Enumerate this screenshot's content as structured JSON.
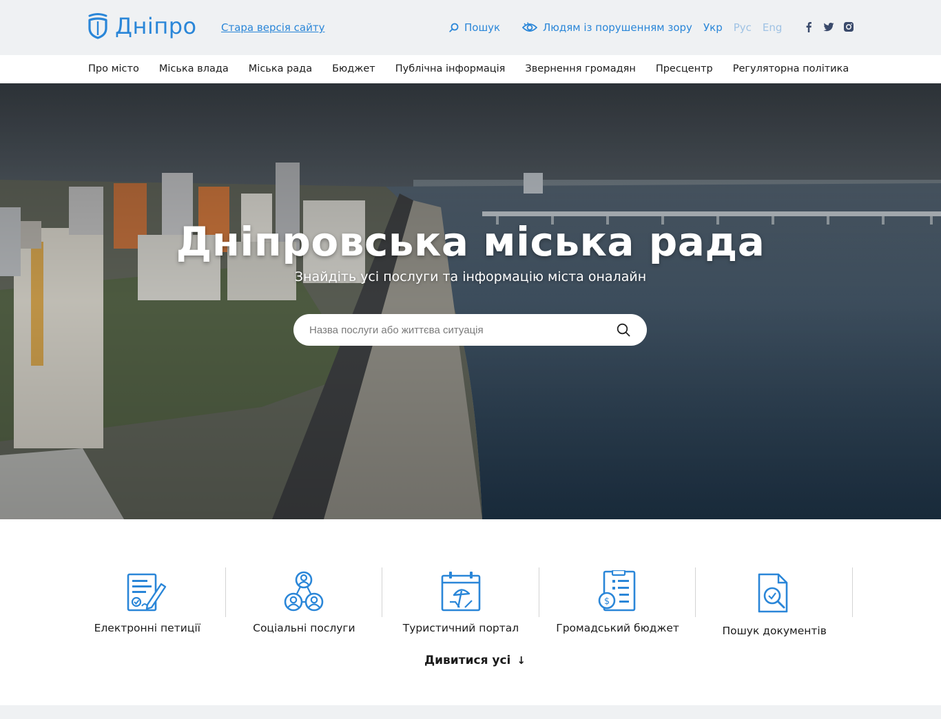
{
  "header": {
    "logo_text": "Дніпро",
    "old_site": "Стара версія сайту",
    "search": "Пошук",
    "vision": "Людям із порушенням зору",
    "languages": [
      "Укр",
      "Рус",
      "Eng"
    ],
    "active_language": "Укр",
    "socials": [
      "facebook-icon",
      "twitter-icon",
      "instagram-icon"
    ]
  },
  "nav": {
    "items": [
      "Про місто",
      "Міська влада",
      "Міська рада",
      "Бюджет",
      "Публічна інформація",
      "Звернення громадян",
      "Пресцентр",
      "Регуляторна політика"
    ]
  },
  "hero": {
    "title": "Дніпровська міська рада",
    "subtitle": "Знайдіть усі послуги та інформацію міста оналайн",
    "search_placeholder": "Назва послуги або життєва ситуація"
  },
  "services": {
    "items": [
      {
        "label": "Електронні петиції",
        "icon": "petition-icon"
      },
      {
        "label": "Соціальні послуги",
        "icon": "social-services-icon"
      },
      {
        "label": "Туристичний портал",
        "icon": "tourism-icon"
      },
      {
        "label": "Громадський бюджет",
        "icon": "budget-icon"
      },
      {
        "label": "Пошук документів",
        "icon": "document-search-icon"
      }
    ],
    "see_all": "Дивитися усі",
    "see_all_arrow": "↓"
  },
  "colors": {
    "accent": "#2a86d8",
    "header_bg": "#eff1f3",
    "inactive_lang": "#9fc2e4"
  }
}
